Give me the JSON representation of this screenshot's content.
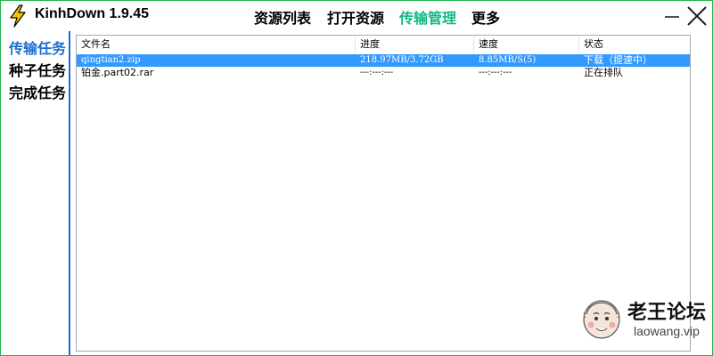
{
  "app": {
    "title": "KinhDown 1.9.45"
  },
  "menu": [
    {
      "label": "资源列表"
    },
    {
      "label": "打开资源"
    },
    {
      "label": "传输管理",
      "active": true
    },
    {
      "label": "更多"
    }
  ],
  "sidebar": {
    "items": [
      {
        "label": "传输任务",
        "active": true
      },
      {
        "label": "种子任务"
      },
      {
        "label": "完成任务"
      }
    ]
  },
  "table": {
    "columns": [
      "文件名",
      "进度",
      "速度",
      "状态"
    ],
    "rows": [
      {
        "name": "qingtian2.zip",
        "progress": "218.97MB/3.72GB",
        "speed": "8.85MB/S(5)",
        "status": "下载（提速中）",
        "selected": true
      },
      {
        "name": "铂金.part02.rar",
        "progress": "---:---:---",
        "speed": "---:---:---",
        "status": "正在排队",
        "selected": false
      }
    ]
  },
  "watermark": {
    "title": "老王论坛",
    "subtitle": "laowang.vip"
  },
  "colors": {
    "accent": "#1e6ad4",
    "active_menu": "#10b981",
    "selection": "#3399ff",
    "frame": "#22b14c"
  },
  "icons": {
    "app": "lightning-bolt-icon",
    "minimize": "minimize-icon",
    "close": "close-icon"
  }
}
